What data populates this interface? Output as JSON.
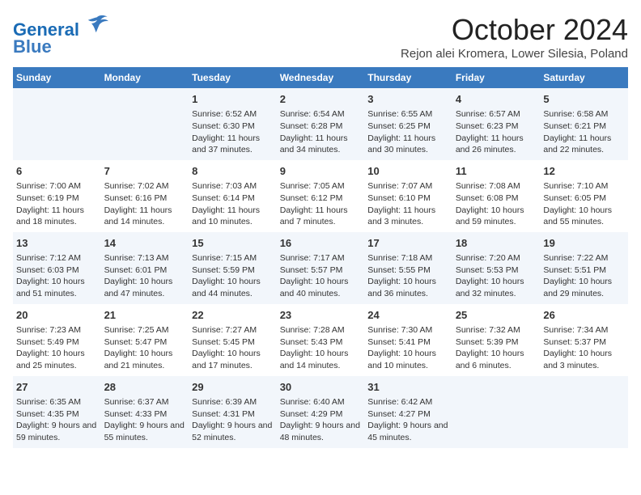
{
  "header": {
    "logo_line1": "General",
    "logo_line2": "Blue",
    "month": "October 2024",
    "location": "Rejon alei Kromera, Lower Silesia, Poland"
  },
  "days_of_week": [
    "Sunday",
    "Monday",
    "Tuesday",
    "Wednesday",
    "Thursday",
    "Friday",
    "Saturday"
  ],
  "weeks": [
    [
      {
        "day": "",
        "data": ""
      },
      {
        "day": "",
        "data": ""
      },
      {
        "day": "1",
        "data": "Sunrise: 6:52 AM\nSunset: 6:30 PM\nDaylight: 11 hours and 37 minutes."
      },
      {
        "day": "2",
        "data": "Sunrise: 6:54 AM\nSunset: 6:28 PM\nDaylight: 11 hours and 34 minutes."
      },
      {
        "day": "3",
        "data": "Sunrise: 6:55 AM\nSunset: 6:25 PM\nDaylight: 11 hours and 30 minutes."
      },
      {
        "day": "4",
        "data": "Sunrise: 6:57 AM\nSunset: 6:23 PM\nDaylight: 11 hours and 26 minutes."
      },
      {
        "day": "5",
        "data": "Sunrise: 6:58 AM\nSunset: 6:21 PM\nDaylight: 11 hours and 22 minutes."
      }
    ],
    [
      {
        "day": "6",
        "data": "Sunrise: 7:00 AM\nSunset: 6:19 PM\nDaylight: 11 hours and 18 minutes."
      },
      {
        "day": "7",
        "data": "Sunrise: 7:02 AM\nSunset: 6:16 PM\nDaylight: 11 hours and 14 minutes."
      },
      {
        "day": "8",
        "data": "Sunrise: 7:03 AM\nSunset: 6:14 PM\nDaylight: 11 hours and 10 minutes."
      },
      {
        "day": "9",
        "data": "Sunrise: 7:05 AM\nSunset: 6:12 PM\nDaylight: 11 hours and 7 minutes."
      },
      {
        "day": "10",
        "data": "Sunrise: 7:07 AM\nSunset: 6:10 PM\nDaylight: 11 hours and 3 minutes."
      },
      {
        "day": "11",
        "data": "Sunrise: 7:08 AM\nSunset: 6:08 PM\nDaylight: 10 hours and 59 minutes."
      },
      {
        "day": "12",
        "data": "Sunrise: 7:10 AM\nSunset: 6:05 PM\nDaylight: 10 hours and 55 minutes."
      }
    ],
    [
      {
        "day": "13",
        "data": "Sunrise: 7:12 AM\nSunset: 6:03 PM\nDaylight: 10 hours and 51 minutes."
      },
      {
        "day": "14",
        "data": "Sunrise: 7:13 AM\nSunset: 6:01 PM\nDaylight: 10 hours and 47 minutes."
      },
      {
        "day": "15",
        "data": "Sunrise: 7:15 AM\nSunset: 5:59 PM\nDaylight: 10 hours and 44 minutes."
      },
      {
        "day": "16",
        "data": "Sunrise: 7:17 AM\nSunset: 5:57 PM\nDaylight: 10 hours and 40 minutes."
      },
      {
        "day": "17",
        "data": "Sunrise: 7:18 AM\nSunset: 5:55 PM\nDaylight: 10 hours and 36 minutes."
      },
      {
        "day": "18",
        "data": "Sunrise: 7:20 AM\nSunset: 5:53 PM\nDaylight: 10 hours and 32 minutes."
      },
      {
        "day": "19",
        "data": "Sunrise: 7:22 AM\nSunset: 5:51 PM\nDaylight: 10 hours and 29 minutes."
      }
    ],
    [
      {
        "day": "20",
        "data": "Sunrise: 7:23 AM\nSunset: 5:49 PM\nDaylight: 10 hours and 25 minutes."
      },
      {
        "day": "21",
        "data": "Sunrise: 7:25 AM\nSunset: 5:47 PM\nDaylight: 10 hours and 21 minutes."
      },
      {
        "day": "22",
        "data": "Sunrise: 7:27 AM\nSunset: 5:45 PM\nDaylight: 10 hours and 17 minutes."
      },
      {
        "day": "23",
        "data": "Sunrise: 7:28 AM\nSunset: 5:43 PM\nDaylight: 10 hours and 14 minutes."
      },
      {
        "day": "24",
        "data": "Sunrise: 7:30 AM\nSunset: 5:41 PM\nDaylight: 10 hours and 10 minutes."
      },
      {
        "day": "25",
        "data": "Sunrise: 7:32 AM\nSunset: 5:39 PM\nDaylight: 10 hours and 6 minutes."
      },
      {
        "day": "26",
        "data": "Sunrise: 7:34 AM\nSunset: 5:37 PM\nDaylight: 10 hours and 3 minutes."
      }
    ],
    [
      {
        "day": "27",
        "data": "Sunrise: 6:35 AM\nSunset: 4:35 PM\nDaylight: 9 hours and 59 minutes."
      },
      {
        "day": "28",
        "data": "Sunrise: 6:37 AM\nSunset: 4:33 PM\nDaylight: 9 hours and 55 minutes."
      },
      {
        "day": "29",
        "data": "Sunrise: 6:39 AM\nSunset: 4:31 PM\nDaylight: 9 hours and 52 minutes."
      },
      {
        "day": "30",
        "data": "Sunrise: 6:40 AM\nSunset: 4:29 PM\nDaylight: 9 hours and 48 minutes."
      },
      {
        "day": "31",
        "data": "Sunrise: 6:42 AM\nSunset: 4:27 PM\nDaylight: 9 hours and 45 minutes."
      },
      {
        "day": "",
        "data": ""
      },
      {
        "day": "",
        "data": ""
      }
    ]
  ]
}
